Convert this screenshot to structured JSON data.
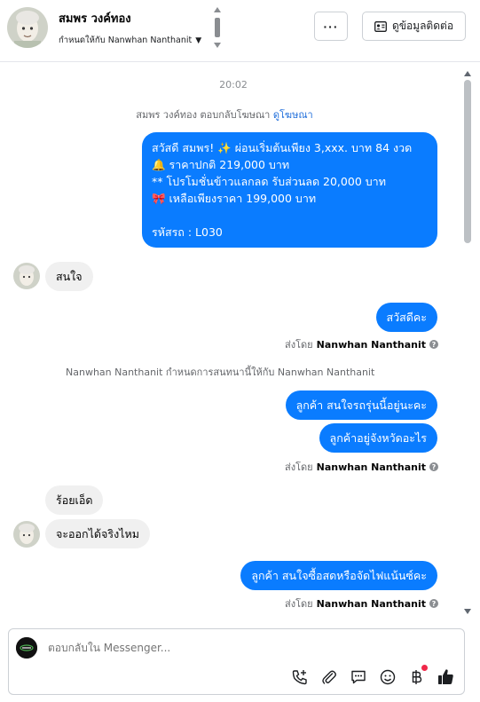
{
  "header": {
    "contact_name": "สมพร วงค์ทอง",
    "assigned_text": "กำหนดให้กับ Nanwhan Nanthanit",
    "more_label": "···",
    "view_contact_label": "ดูข้อมูลติดต่อ"
  },
  "conversation": {
    "timestamp": "20:02",
    "reply_note_prefix": "สมพร วงค์ทอง ตอบกลับโฆษณา",
    "reply_note_link": "ดูโฆษณา",
    "ad_message_lines": [
      "สวัสดี สมพร! ✨  ผ่อนเริ่มต้นเพียง 3,xxx. บาท 84 งวด",
      "🔔 ราคาปกติ 219,000 บาท",
      "** โปรโมชั่นข้าวแลกลด รับส่วนลด 20,000 บาท",
      "🎀  เหลือเพียงราคา 199,000 บาท",
      "",
      "รหัสรถ : L030"
    ],
    "msg_in_1": "สนใจ",
    "msg_out_1": "สวัสดีคะ",
    "sent_by_prefix_1": "ส่งโดย",
    "sent_by_name_1": "Nanwhan Nanthanit",
    "assign_note": "Nanwhan Nanthanit กำหนดการสนทนานี้ให้กับ Nanwhan Nanthanit",
    "msg_out_2": "ลูกค้า สนใจรถรุ่นนี้อยู่นะคะ",
    "msg_out_3": "ลูกค้าอยู่จังหวัดอะไร",
    "sent_by_prefix_2": "ส่งโดย",
    "sent_by_name_2": "Nanwhan Nanthanit",
    "msg_in_2": "ร้อยเอ็ด",
    "msg_in_3": "จะออกได้จริงไหม",
    "msg_out_4": "ลูกค้า สนใจซื้อสดหรือจัดไฟแน้นซ์คะ",
    "sent_by_prefix_3": "ส่งโดย",
    "sent_by_name_3": "Nanwhan Nanthanit"
  },
  "composer": {
    "placeholder": "ตอบกลับใน Messenger...",
    "tools": [
      "phone-plus-icon",
      "paperclip-icon",
      "saved-reply-icon",
      "emoji-icon",
      "baht-icon",
      "thumbs-up-icon"
    ]
  },
  "colors": {
    "outgoing_bubble": "#0a7cff",
    "incoming_bubble": "#f0f0f0",
    "link": "#216fdb",
    "notification_dot": "#f02849"
  }
}
